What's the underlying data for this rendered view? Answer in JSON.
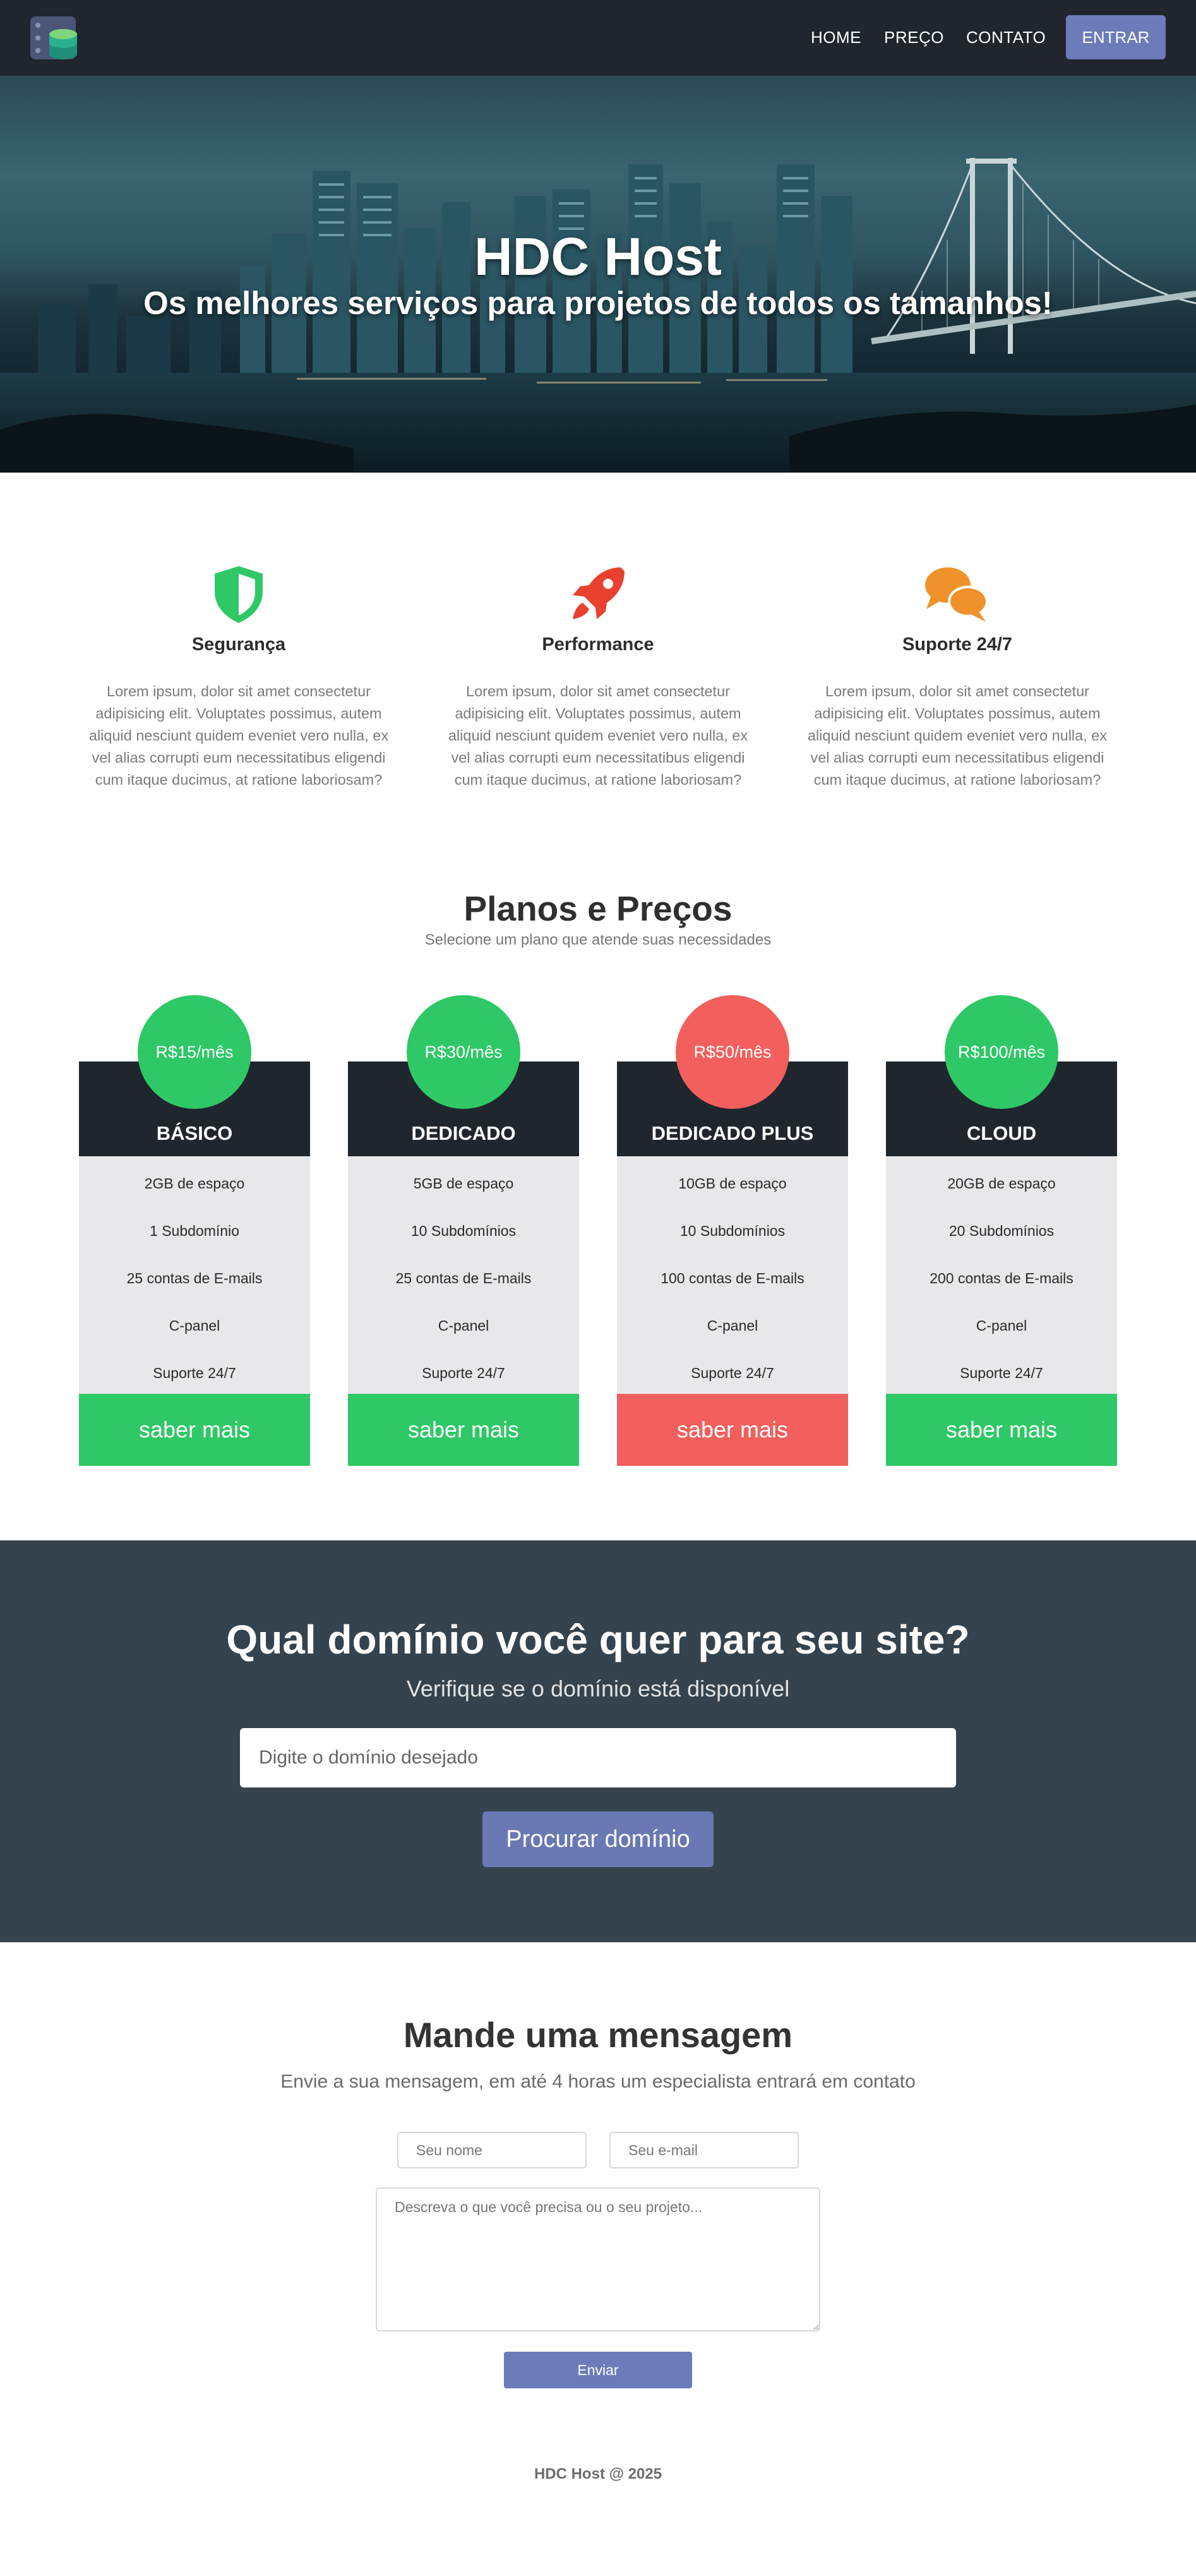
{
  "nav": {
    "links": [
      "HOME",
      "PREÇO",
      "CONTATO"
    ],
    "login_label": "ENTRAR",
    "logo_icon": "server-database-icon"
  },
  "hero": {
    "title": "HDC Host",
    "subtitle": "Os melhores serviços para projetos de todos os tamanhos!"
  },
  "features": [
    {
      "icon": "shield-icon",
      "color": "#2ec866",
      "title": "Segurança",
      "text": "Lorem ipsum, dolor sit amet consectetur adipisicing elit. Voluptates possimus, autem aliquid nesciunt quidem eveniet vero nulla, ex vel alias corrupti eum necessitatibus eligendi cum itaque ducimus, at ratione laboriosam?"
    },
    {
      "icon": "rocket-icon",
      "color": "#e8412f",
      "title": "Performance",
      "text": "Lorem ipsum, dolor sit amet consectetur adipisicing elit. Voluptates possimus, autem aliquid nesciunt quidem eveniet vero nulla, ex vel alias corrupti eum necessitatibus eligendi cum itaque ducimus, at ratione laboriosam?"
    },
    {
      "icon": "chat-bubbles-icon",
      "color": "#f0922b",
      "title": "Suporte 24/7",
      "text": "Lorem ipsum, dolor sit amet consectetur adipisicing elit. Voluptates possimus, autem aliquid nesciunt quidem eveniet vero nulla, ex vel alias corrupti eum necessitatibus eligendi cum itaque ducimus, at ratione laboriosam?"
    }
  ],
  "plans": {
    "title": "Planos e Preços",
    "subtitle": "Selecione um plano que atende suas necessidades",
    "items": [
      {
        "price": "R$15/mês",
        "name": "BÁSICO",
        "color": "#2ec866",
        "features": [
          "2GB de espaço",
          "1 Subdomínio",
          "25 contas de E-mails",
          "C-panel",
          "Suporte 24/7"
        ],
        "button": "saber mais"
      },
      {
        "price": "R$30/mês",
        "name": "DEDICADO",
        "color": "#2ec866",
        "features": [
          "5GB de espaço",
          "10 Subdomínios",
          "25 contas de E-mails",
          "C-panel",
          "Suporte 24/7"
        ],
        "button": "saber mais"
      },
      {
        "price": "R$50/mês",
        "name": "DEDICADO PLUS",
        "color": "#f25f5c",
        "features": [
          "10GB de espaço",
          "10 Subdomínios",
          "100 contas de E-mails",
          "C-panel",
          "Suporte 24/7"
        ],
        "button": "saber mais"
      },
      {
        "price": "R$100/mês",
        "name": "CLOUD",
        "color": "#2ec866",
        "features": [
          "20GB de espaço",
          "20 Subdomínios",
          "200 contas de E-mails",
          "C-panel",
          "Suporte 24/7"
        ],
        "button": "saber mais"
      }
    ]
  },
  "domain": {
    "title": "Qual domínio você quer para seu site?",
    "subtitle": "Verifique se o domínio está disponível",
    "input_placeholder": "Digite o domínio desejado",
    "input_value": "",
    "button": "Procurar domínio"
  },
  "contact": {
    "title": "Mande uma mensagem",
    "subtitle": "Envie a sua mensagem, em até 4 horas um especialista entrará em contato",
    "name_placeholder": "Seu nome",
    "email_placeholder": "Seu e-mail",
    "message_placeholder": "Descreva o que você precisa ou o seu projeto...",
    "send_button": "Enviar"
  },
  "footer": {
    "text": "HDC Host @ 2025"
  }
}
